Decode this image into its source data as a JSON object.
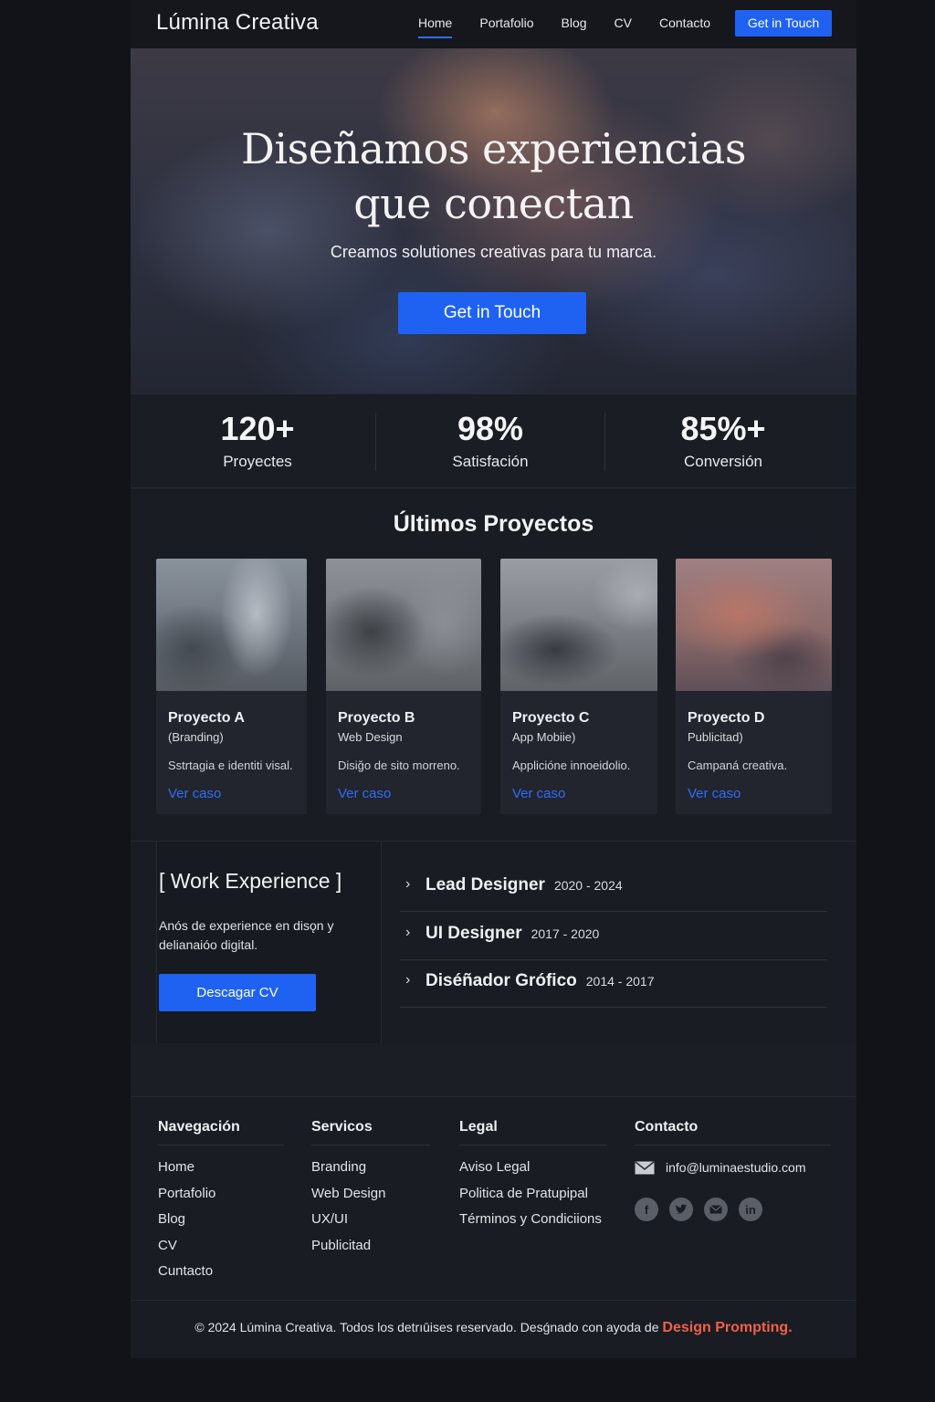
{
  "nav": {
    "brand": "Lúmina Creativa",
    "links": [
      "Home",
      "Portafolio",
      "Blog",
      "CV",
      "Contacto"
    ],
    "active": "Home",
    "cta": "Get in Touch"
  },
  "hero": {
    "title_line1": "Diseñamos experiencias",
    "title_line2": "que conectan",
    "subtitle": "Creamos solutiones creativas para tu marca.",
    "cta": "Get in Touch"
  },
  "stats": [
    {
      "value": "120+",
      "label": "Proyectes"
    },
    {
      "value": "98%",
      "label": "Satisfación"
    },
    {
      "value": "85%+",
      "label": "Conversión"
    }
  ],
  "projects": {
    "title": "Últimos Proyectos",
    "items": [
      {
        "name": "Proyecto A",
        "category": "(Branding)",
        "description": "Sstrtagia e identiti visal.",
        "link": "Ver caso"
      },
      {
        "name": "Proyecto B",
        "category": "Web Design",
        "description": "Disiğo de sito morreno.",
        "link": "Ver caso"
      },
      {
        "name": "Proyecto C",
        "category": "App Mobiie)",
        "description": "Applicióne innoeidolio.",
        "link": "Ver caso"
      },
      {
        "name": "Proyecto D",
        "category": "Publicitad)",
        "description": "Campaná creativa.",
        "link": "Ver caso"
      }
    ]
  },
  "work": {
    "title": "[ Work Experience ]",
    "description": "Anós de experience en disǫn y delianaióo digital.",
    "button": "Descagar CV",
    "jobs": [
      {
        "role": "Lead Designer",
        "years": "2020 - 2024"
      },
      {
        "role": "UI Designer",
        "years": "2017 - 2020"
      },
      {
        "role": "Diséñador Grófico",
        "years": "2014 - 2017"
      }
    ]
  },
  "footer": {
    "navegacion": {
      "title": "Navegación",
      "items": [
        "Home",
        "Portafolio",
        "Blog",
        "CV",
        "Cuntacto"
      ]
    },
    "servicios": {
      "title": "Servicos",
      "items": [
        "Branding",
        "Web Design",
        "UX/UI",
        "Publicitad"
      ]
    },
    "legal": {
      "title": "Legal",
      "items": [
        "Aviso Legal",
        "Politica de Pratupipal",
        "Términos y Condiciions"
      ]
    },
    "contacto": {
      "title": "Contacto",
      "email": "info@luminaestudio.com"
    },
    "socials": [
      "facebook-icon",
      "twitter-icon",
      "mail-icon",
      "linkedin-icon"
    ],
    "copyright": "© 2024 Lúmina Creativa. Todos los detrıūises reservado. Desǵnado con ayoda de",
    "credit": "Design Prompting",
    "credit_suffix": "."
  },
  "colors": {
    "accent": "#1f62f2",
    "background": "#111318",
    "credit": "#f06148"
  }
}
